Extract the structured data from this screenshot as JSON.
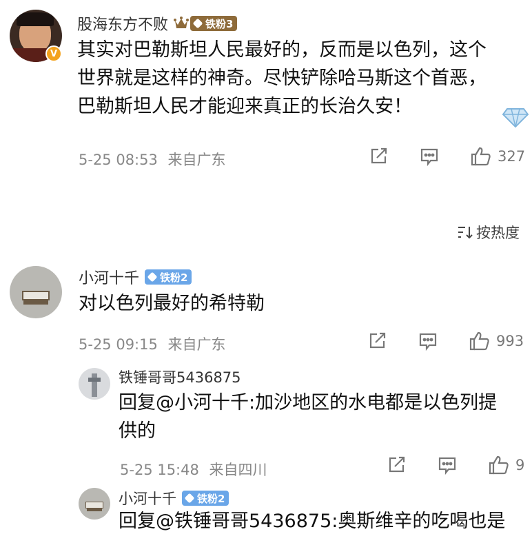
{
  "comments": [
    {
      "username": "股海东方不败",
      "badge": "铁粉3",
      "text_lines": [
        "其实对巴勒斯坦人民最好的，反而是以色列，这个",
        "世界就是这样的神奇。尽快铲除哈马斯这个首恶，",
        "巴勒斯坦人民才能迎来真正的长治久安！"
      ],
      "time": "5-25 08:53",
      "location": "来自广东",
      "likes": "327"
    },
    {
      "username": "小河十千",
      "badge": "铁粉2",
      "text_lines": [
        "对以色列最好的希特勒"
      ],
      "time": "5-25 09:15",
      "location": "来自广东",
      "likes": "993"
    }
  ],
  "replies": [
    {
      "username": "铁锤哥哥5436875",
      "text_lines": [
        "回复@小河十千:加沙地区的水电都是以色列提",
        "供的"
      ],
      "time": "5-25 15:48",
      "location": "来自四川",
      "likes": "9"
    },
    {
      "username": "小河十千",
      "badge": "铁粉2",
      "text_lines": [
        "回复@铁锤哥哥5436875:奥斯维辛的吃喝也是"
      ]
    }
  ],
  "sort_label": "按热度",
  "colors": {
    "badge_gold": "#d9a13b",
    "badge_blue": "#6aa6e8",
    "verified": "#f3a21d"
  }
}
